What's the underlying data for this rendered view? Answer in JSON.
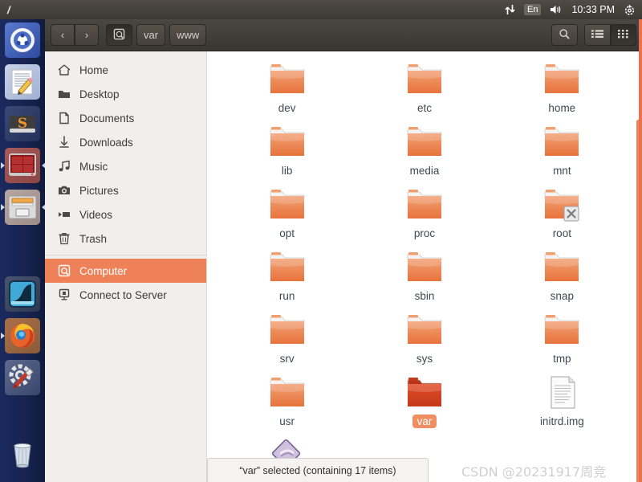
{
  "panel": {
    "title": "/",
    "indicators": {
      "network_icon": "network-updown-icon",
      "keyboard_label": "En",
      "volume_icon": "volume-icon",
      "clock": "10:33 PM",
      "gear_icon": "gear-icon"
    }
  },
  "launcher": {
    "items": [
      {
        "name": "ubuntu-dash",
        "label": "Ubuntu Dash"
      },
      {
        "name": "text-editor",
        "label": "Text Editor"
      },
      {
        "name": "sublime-text",
        "label": "Sublime Text"
      },
      {
        "name": "terminal-app",
        "label": "Terminal"
      },
      {
        "name": "file-manager",
        "label": "Files"
      },
      {
        "name": "wireshark",
        "label": "Wireshark"
      },
      {
        "name": "firefox",
        "label": "Firefox"
      },
      {
        "name": "system-settings",
        "label": "System Settings"
      },
      {
        "name": "trash",
        "label": "Trash"
      }
    ]
  },
  "toolbar": {
    "back_label": "‹",
    "forward_label": "›",
    "computer_icon": "computer-icon",
    "breadcrumbs": [
      {
        "label": "var"
      },
      {
        "label": "www"
      }
    ],
    "search_icon": "search-icon",
    "list_view_icon": "list-view-icon",
    "grid_view_icon": "grid-view-icon",
    "active_view": "grid"
  },
  "sidebar": {
    "items": [
      {
        "label": "Home",
        "icon": "home-icon",
        "selected": false
      },
      {
        "label": "Desktop",
        "icon": "desktop-icon",
        "selected": false
      },
      {
        "label": "Documents",
        "icon": "document-icon",
        "selected": false
      },
      {
        "label": "Downloads",
        "icon": "download-icon",
        "selected": false
      },
      {
        "label": "Music",
        "icon": "music-icon",
        "selected": false
      },
      {
        "label": "Pictures",
        "icon": "camera-icon",
        "selected": false
      },
      {
        "label": "Videos",
        "icon": "video-icon",
        "selected": false
      },
      {
        "label": "Trash",
        "icon": "trash-icon",
        "selected": false
      },
      {
        "label": "Computer",
        "icon": "computer-icon",
        "selected": true
      },
      {
        "label": "Connect to Server",
        "icon": "server-icon",
        "selected": false
      }
    ]
  },
  "files": [
    {
      "name": "dev",
      "type": "folder",
      "selected": false,
      "emblem": ""
    },
    {
      "name": "etc",
      "type": "folder",
      "selected": false,
      "emblem": ""
    },
    {
      "name": "home",
      "type": "folder",
      "selected": false,
      "emblem": ""
    },
    {
      "name": "lib",
      "type": "folder",
      "selected": false,
      "emblem": ""
    },
    {
      "name": "media",
      "type": "folder",
      "selected": false,
      "emblem": ""
    },
    {
      "name": "mnt",
      "type": "folder",
      "selected": false,
      "emblem": ""
    },
    {
      "name": "opt",
      "type": "folder",
      "selected": false,
      "emblem": ""
    },
    {
      "name": "proc",
      "type": "folder",
      "selected": false,
      "emblem": ""
    },
    {
      "name": "root",
      "type": "folder",
      "selected": false,
      "emblem": "no-access"
    },
    {
      "name": "run",
      "type": "folder",
      "selected": false,
      "emblem": ""
    },
    {
      "name": "sbin",
      "type": "folder",
      "selected": false,
      "emblem": ""
    },
    {
      "name": "snap",
      "type": "folder",
      "selected": false,
      "emblem": ""
    },
    {
      "name": "srv",
      "type": "folder",
      "selected": false,
      "emblem": ""
    },
    {
      "name": "sys",
      "type": "folder",
      "selected": false,
      "emblem": ""
    },
    {
      "name": "tmp",
      "type": "folder",
      "selected": false,
      "emblem": ""
    },
    {
      "name": "usr",
      "type": "folder",
      "selected": false,
      "emblem": ""
    },
    {
      "name": "var",
      "type": "folder",
      "selected": true,
      "emblem": ""
    },
    {
      "name": "initrd.img",
      "type": "file",
      "selected": false,
      "emblem": ""
    },
    {
      "name": "",
      "type": "symlink",
      "selected": false,
      "emblem": ""
    }
  ],
  "statusbar": {
    "text": "“var” selected  (containing 17 items)"
  },
  "watermark": {
    "text": "CSDN @20231917周竞"
  },
  "colors": {
    "accent_orange": "#ef8158",
    "folder_orange": "#e8733c",
    "selected_folder": "#d9472a",
    "panel_dark": "#3c3833",
    "launcher_blue": "#16224d"
  }
}
